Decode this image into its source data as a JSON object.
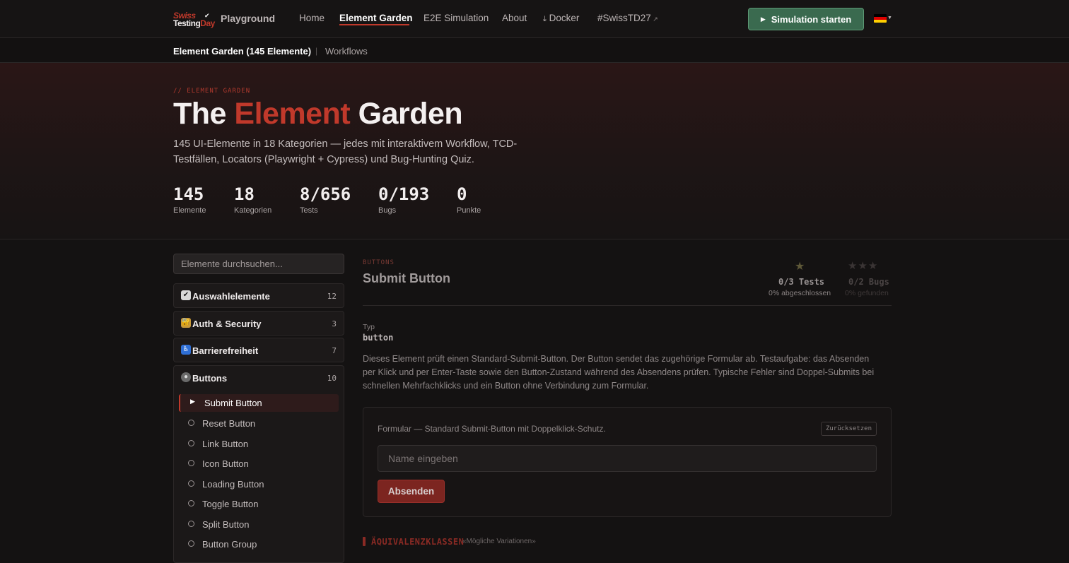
{
  "nav": {
    "logo_swiss": "Swiss",
    "logo_testing": "Testing",
    "logo_day": "Day",
    "brand": "Playground",
    "items": [
      {
        "label": "Home"
      },
      {
        "label": "Element Garden"
      },
      {
        "label": "E2E Simulation"
      },
      {
        "label": "About"
      },
      {
        "label": "Docker"
      },
      {
        "label": "#SwissTD27"
      }
    ],
    "cta": "Simulation starten",
    "flag_colors": [
      "#000000",
      "#dd0000",
      "#ffce00"
    ]
  },
  "subnav": {
    "active": "Element Garden (145 Elemente)",
    "sep": "|",
    "other": "Workflows"
  },
  "hero": {
    "eyebrow": "// ELEMENT GARDEN",
    "title_pre": "The ",
    "title_accent": "Element",
    "title_post": " Garden",
    "description": "145 UI-Elemente in 18 Kategorien — jedes mit interaktivem Workflow, TCD-Testfällen, Locators (Playwright + Cypress) und Bug-Hunting Quiz.",
    "stats": [
      {
        "value": "145",
        "label": "Elemente"
      },
      {
        "value": "18",
        "label": "Kategorien"
      },
      {
        "value": "8/656",
        "label": "Tests"
      },
      {
        "value": "0/193",
        "label": "Bugs"
      },
      {
        "value": "0",
        "label": "Punkte"
      }
    ]
  },
  "sidebar": {
    "search_placeholder": "Elemente durchsuchen...",
    "categories": [
      {
        "name": "Auswahlelemente",
        "count": "12"
      },
      {
        "name": "Auth & Security",
        "count": "3"
      },
      {
        "name": "Barrierefreiheit",
        "count": "7"
      },
      {
        "name": "Buttons",
        "count": "10"
      }
    ],
    "button_items": [
      {
        "label": "Submit Button"
      },
      {
        "label": "Reset Button"
      },
      {
        "label": "Link Button"
      },
      {
        "label": "Icon Button"
      },
      {
        "label": "Loading Button"
      },
      {
        "label": "Toggle Button"
      },
      {
        "label": "Split Button"
      },
      {
        "label": "Button Group"
      }
    ]
  },
  "main": {
    "eyebrow": "BUTTONS",
    "title": "Submit Button",
    "tests_count": "0/3 Tests",
    "tests_sub": "0% abgeschlossen",
    "bugs_count": "0/2 Bugs",
    "bugs_sub": "0% gefunden",
    "type_label": "Typ",
    "type_value": "button",
    "description": "Dieses Element prüft einen Standard-Submit-Button. Der Button sendet das zugehörige Formular ab. Testaufgabe: das Absenden per Klick und per Enter-Taste sowie den Button-Zustand während des Absendens prüfen. Typische Fehler sind Doppel-Submits bei schnellen Mehrfachklicks und ein Button ohne Verbindung zum Formular.",
    "form_caption": "Formular — Standard Submit-Button mit Doppelklick-Schutz.",
    "reset_label": "Zurücksetzen",
    "name_placeholder": "Name eingeben",
    "submit_label": "Absenden",
    "section_title": "ÄQUIVALENZKLASSEN",
    "section_sub": "«Mögliche Variationen»"
  }
}
